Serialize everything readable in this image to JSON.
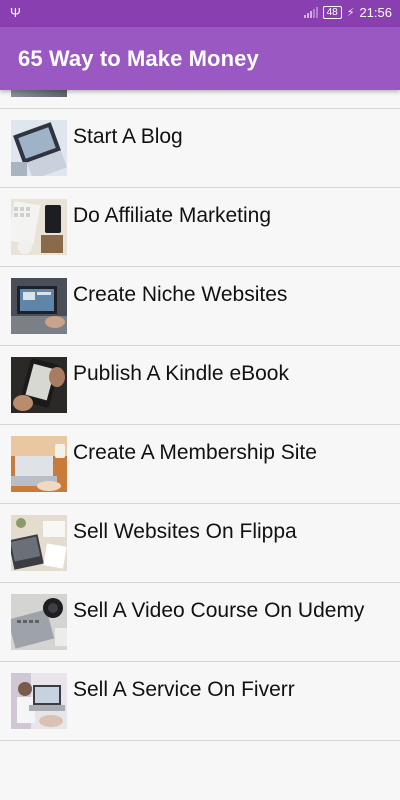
{
  "status_bar": {
    "battery": "48",
    "time": "21:56",
    "usb_icon": "usb-icon",
    "signal_icon": "signal-icon",
    "charging_icon": "charging-icon"
  },
  "app_bar": {
    "title": "65 Way to Make Money",
    "color": "#9a59c2"
  },
  "list": {
    "items": [
      {
        "label": "Start A Blog",
        "thumbnail": "laptop-desk-image"
      },
      {
        "label": "Do Affiliate Marketing",
        "thumbnail": "keyboard-phone-image"
      },
      {
        "label": "Create Niche Websites",
        "thumbnail": "laptop-typing-image"
      },
      {
        "label": "Publish A Kindle eBook",
        "thumbnail": "ereader-image"
      },
      {
        "label": "Create A Membership Site",
        "thumbnail": "laptop-coffee-image"
      },
      {
        "label": "Sell Websites On Flippa",
        "thumbnail": "desk-workspace-image"
      },
      {
        "label": "Sell A Video Course On Udemy",
        "thumbnail": "laptop-camera-image"
      },
      {
        "label": "Sell A Service On Fiverr",
        "thumbnail": "person-laptop-image"
      }
    ]
  }
}
